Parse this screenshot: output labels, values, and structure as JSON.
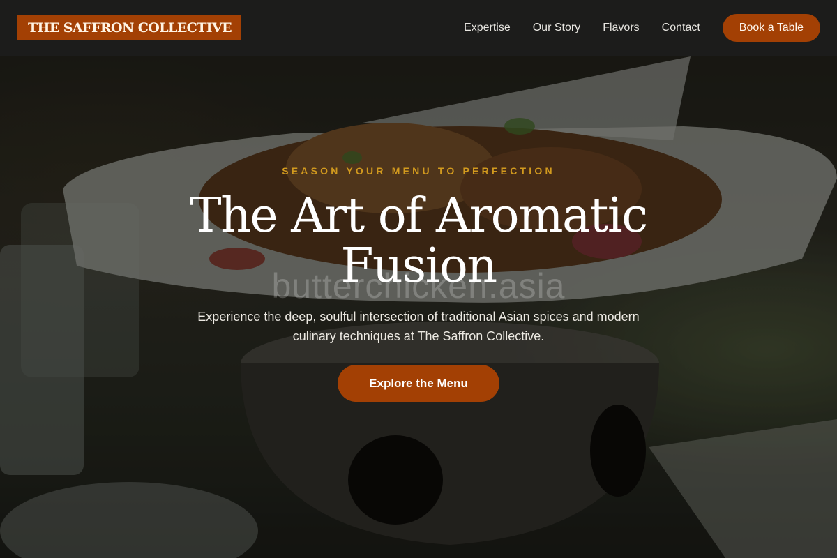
{
  "brand": {
    "logo_text": "THE SAFFRON COLLECTIVE"
  },
  "nav": {
    "links": [
      {
        "label": "Expertise"
      },
      {
        "label": "Our Story"
      },
      {
        "label": "Flavors"
      },
      {
        "label": "Contact"
      }
    ],
    "cta_label": "Book a Table"
  },
  "hero": {
    "eyebrow": "SEASON YOUR MENU TO PERFECTION",
    "title": "The Art of Aromatic Fusion",
    "watermark": "butterchicken.asia",
    "description": "Experience the deep, soulful intersection of traditional Asian spices and modern culinary techniques at The Saffron Collective.",
    "cta_label": "Explore the Menu"
  },
  "colors": {
    "accent": "#a34004",
    "eyebrow": "#d29a1e",
    "nav_background": "#1c1c1b"
  }
}
